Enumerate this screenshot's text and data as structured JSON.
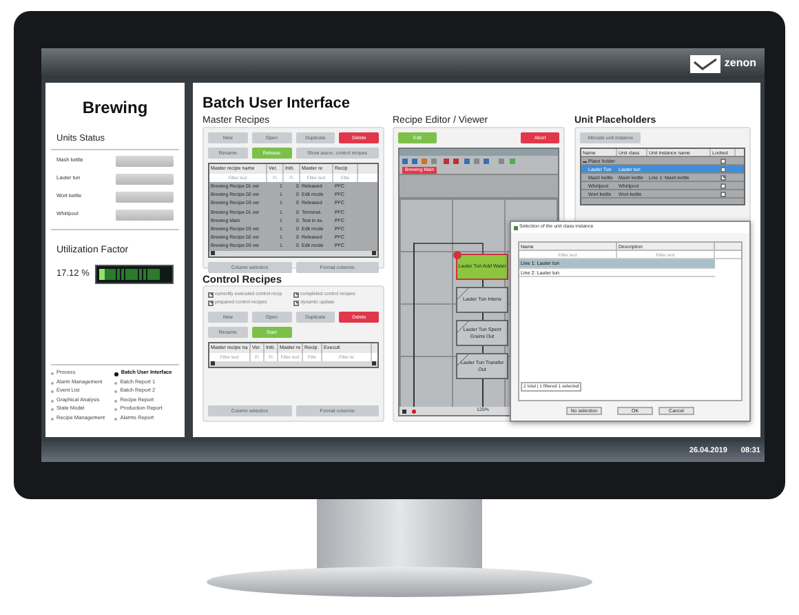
{
  "header": {
    "logo": "zenon"
  },
  "sidebar": {
    "title": "Brewing",
    "units_heading": "Units Status",
    "units": [
      {
        "name": "Mash kettle"
      },
      {
        "name": "Lauter tun"
      },
      {
        "name": "Wort kettle"
      },
      {
        "name": "Whirlpool"
      }
    ],
    "utilization_heading": "Utilization Factor",
    "utilization": {
      "reading": "17.12 %",
      "level": 0.08
    },
    "nav": [
      {
        "label": "Process",
        "selected": false
      },
      {
        "label": "Alarm Management",
        "selected": false
      },
      {
        "label": "Event List",
        "selected": false
      },
      {
        "label": "Graphical Analysis",
        "selected": false
      },
      {
        "label": "State Model",
        "selected": false
      },
      {
        "label": "Recipe Management",
        "selected": false
      },
      {
        "label": "Batch User Interface",
        "selected": true
      },
      {
        "label": "Batch Report 1",
        "selected": false
      },
      {
        "label": "Batch Report 2",
        "selected": false
      },
      {
        "label": "Recipe Report",
        "selected": false
      },
      {
        "label": "Production Report",
        "selected": false
      },
      {
        "label": "Alarms Report",
        "selected": false
      }
    ]
  },
  "main": {
    "title": "Batch User Interface",
    "master_recipes": {
      "heading": "Master Recipes",
      "buttons": [
        {
          "label": "New",
          "kind": "plain"
        },
        {
          "label": "Open",
          "kind": "plain"
        },
        {
          "label": "Duplicate",
          "kind": "plain"
        },
        {
          "label": "Delete",
          "kind": "danger"
        },
        {
          "label": "Rename",
          "kind": "plain"
        },
        {
          "label": "Release",
          "kind": "confirm"
        },
        {
          "label": "Show assoc. control recipes",
          "kind": "wide"
        }
      ],
      "columns": [
        "Master recipe name",
        "Ver.",
        "Initi.",
        "Master re",
        "Recip"
      ],
      "filters": [
        "Filter text",
        "Fi",
        "Fi",
        "Filter text",
        "Filte"
      ],
      "rows": [
        [
          "Brewing Recipe 01 ver",
          "1",
          "0",
          "Released",
          "PFC"
        ],
        [
          "Brewing Recipe 02 ver",
          "1",
          "0",
          "Edit mode",
          "PFC"
        ],
        [
          "Brewing Recipe 03 ver",
          "1",
          "0",
          "Released",
          "PFC"
        ],
        [
          "Brewing Recipe 01 ver",
          "1",
          "0",
          "Terminat.",
          "PFC"
        ],
        [
          "Brewing Main",
          "1",
          "0",
          "Test in ex.",
          "PFC"
        ],
        [
          "Brewing Recipe 03 ver",
          "1",
          "0",
          "Edit mode",
          "PFC"
        ],
        [
          "Brewing Recipe 02 ver",
          "1",
          "0",
          "Released",
          "PFC"
        ],
        [
          "Brewing Recipe 03 ver",
          "1",
          "0",
          "Edit mode",
          "PFC"
        ]
      ],
      "footer_buttons": [
        "Column selection",
        "Format columns"
      ]
    },
    "control_recipes": {
      "heading": "Control Recipes",
      "options": [
        {
          "label": "currently executed control recip",
          "checked": true
        },
        {
          "label": "completed control recipes",
          "checked": true
        },
        {
          "label": "prepared control recipes",
          "checked": true
        },
        {
          "label": "dynamic update",
          "checked": true
        }
      ],
      "buttons": [
        {
          "label": "New",
          "kind": "plain"
        },
        {
          "label": "Open",
          "kind": "plain"
        },
        {
          "label": "Duplicate",
          "kind": "plain"
        },
        {
          "label": "Delete",
          "kind": "danger"
        },
        {
          "label": "Rename",
          "kind": "plain"
        },
        {
          "label": "Start",
          "kind": "confirm"
        }
      ],
      "columns": [
        "Master recipe na",
        "Ver.",
        "Initi.",
        "Master re",
        "Recip.",
        "Executi"
      ],
      "filters": [
        "Filter text",
        "Fi",
        "Fi",
        "Filter text",
        "Filte",
        "Filter te"
      ],
      "footer_buttons": [
        "Column selection",
        "Format columns"
      ]
    },
    "recipe_editor": {
      "heading": "Recipe Editor / Viewer",
      "buttons": [
        {
          "label": "Edit",
          "kind": "confirm"
        },
        {
          "label": "Abort",
          "kind": "danger"
        }
      ],
      "tab": "Brewing Main",
      "steps": [
        {
          "label": "Lauter Tun Add Water",
          "selected": true
        },
        {
          "label": "Lauter Tun Intens",
          "selected": false
        },
        {
          "label": "Lauter Tun Spent Grains Out",
          "selected": false
        },
        {
          "label": "Lauter Tun Transfer Out",
          "selected": false
        }
      ],
      "zoom": "120%"
    },
    "unit_placeholders": {
      "heading": "Unit Placeholders",
      "button": "Allocate unit instance",
      "columns": [
        "Name",
        "Unit class",
        "Unit instance name",
        "Locked"
      ],
      "rows": [
        {
          "name": "Place holder",
          "expanded": true,
          "locked": false,
          "selected": false,
          "children": [
            {
              "name": "Lauter Tun",
              "unit_class": "Lauter tun",
              "locked": false,
              "selected": true
            },
            {
              "name": "Mash kettle",
              "unit_class": "Mash kettle",
              "instance": "Line 1: Mash kettle",
              "locked": true,
              "selected": false
            },
            {
              "name": "Whirlpool",
              "unit_class": "Whirlpool",
              "locked": false,
              "selected": false
            },
            {
              "name": "Wort kettle",
              "unit_class": "Wort kettle",
              "locked": false,
              "selected": false
            }
          ]
        }
      ]
    },
    "dialog": {
      "title": "Selection of the unit class instance",
      "columns": [
        "Name",
        "Description"
      ],
      "filters": [
        "Filter text",
        "Filter text"
      ],
      "rows": [
        {
          "name": "Line 1: Lauter tun",
          "selected": true
        },
        {
          "name": "Line 2: Lauter tun",
          "selected": false
        }
      ],
      "status": "2 total | 1 filtered 1 selected",
      "buttons": [
        {
          "label": "No selection"
        },
        {
          "label": "OK"
        },
        {
          "label": "Cancel"
        }
      ]
    }
  },
  "status_bar": {
    "date": "26.04.2019",
    "time": "08:31"
  }
}
